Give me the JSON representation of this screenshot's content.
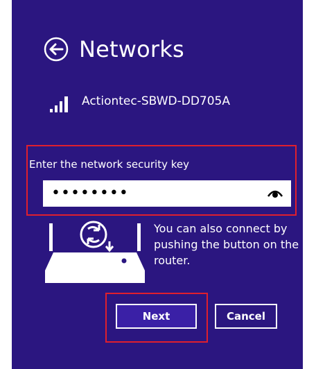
{
  "header": {
    "title": "Networks",
    "back_icon": "back-arrow-circle-icon"
  },
  "network": {
    "name": "Actiontec-SBWD-DD705A",
    "signal_icon": "wifi-signal-bars-icon"
  },
  "security_key": {
    "label": "Enter the network security key",
    "value": "••••••••",
    "reveal_icon": "eye-icon"
  },
  "wps": {
    "router_icon": "router-wps-icon",
    "message": "You can also connect by pushing the button on the router."
  },
  "buttons": {
    "next_label": "Next",
    "cancel_label": "Cancel"
  },
  "colors": {
    "background": "#2b1680",
    "highlight": "#e01f2d",
    "text": "#ffffff"
  }
}
